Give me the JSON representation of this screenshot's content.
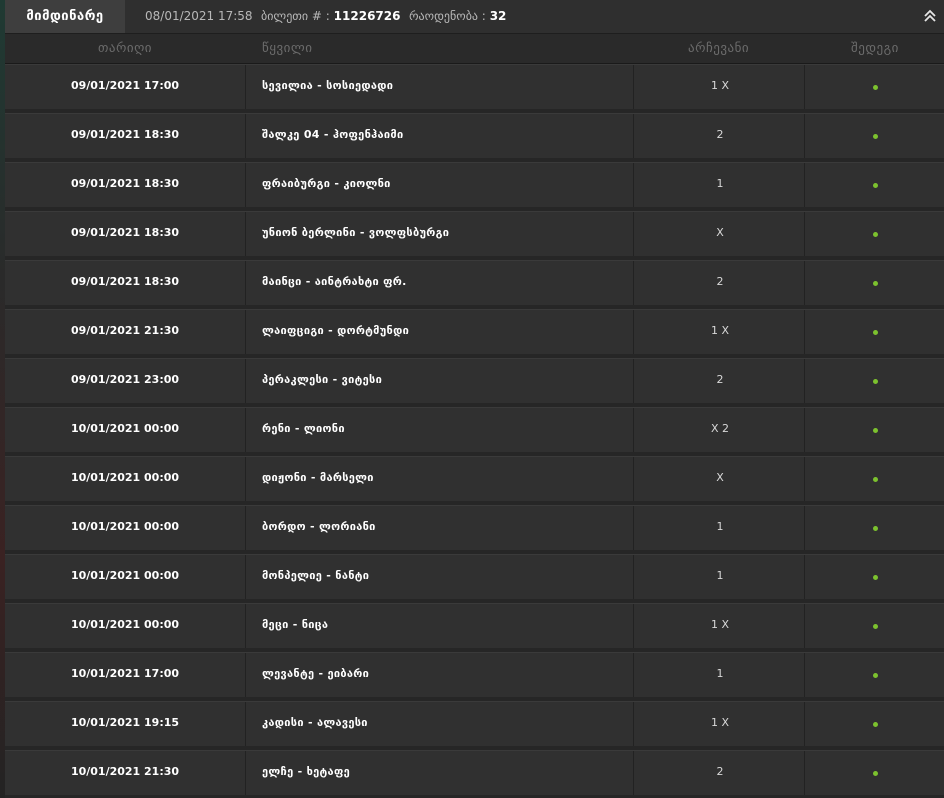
{
  "header": {
    "status_label": "მიმდინარე",
    "date": "08/01/2021 17:58",
    "ticket_label": "ბილეთი # :",
    "ticket_number": "11226726",
    "count_label": "რაოდენობა :",
    "count_value": "32"
  },
  "columns": {
    "date": "თარიღი",
    "match": "წყვილი",
    "pick": "არჩევანი",
    "result": "შედეგი"
  },
  "colors": {
    "status_dot": "#7cc22e"
  },
  "rows": [
    {
      "date": "09/01/2021 17:00",
      "match": "სევილია - სოსიედადი",
      "pick": "1 X"
    },
    {
      "date": "09/01/2021 18:30",
      "match": "შალკე 04 - ჰოფენჰაიმი",
      "pick": "2"
    },
    {
      "date": "09/01/2021 18:30",
      "match": "ფრაიბურგი - კიოლნი",
      "pick": "1"
    },
    {
      "date": "09/01/2021 18:30",
      "match": "უნიონ ბერლინი - ვოლფსბურგი",
      "pick": "X"
    },
    {
      "date": "09/01/2021 18:30",
      "match": "მაინცი - აინტრახტი ფრ.",
      "pick": "2"
    },
    {
      "date": "09/01/2021 21:30",
      "match": "ლაიფციგი - დორტმუნდი",
      "pick": "1 X"
    },
    {
      "date": "09/01/2021 23:00",
      "match": "პერაკლესი - ვიტესი",
      "pick": "2"
    },
    {
      "date": "10/01/2021 00:00",
      "match": "რენი - ლიონი",
      "pick": "X 2"
    },
    {
      "date": "10/01/2021 00:00",
      "match": "დიჟონი - მარსელი",
      "pick": "X"
    },
    {
      "date": "10/01/2021 00:00",
      "match": "ბორდო - ლორიანი",
      "pick": "1"
    },
    {
      "date": "10/01/2021 00:00",
      "match": "მონპელიე - ნანტი",
      "pick": "1"
    },
    {
      "date": "10/01/2021 00:00",
      "match": "მეცი - ნიცა",
      "pick": "1 X"
    },
    {
      "date": "10/01/2021 17:00",
      "match": "ლევანტე - ეიბარი",
      "pick": "1"
    },
    {
      "date": "10/01/2021 19:15",
      "match": "კადისი - ალავესი",
      "pick": "1 X"
    },
    {
      "date": "10/01/2021 21:30",
      "match": "ელჩე - ხეტაფე",
      "pick": "2"
    }
  ]
}
